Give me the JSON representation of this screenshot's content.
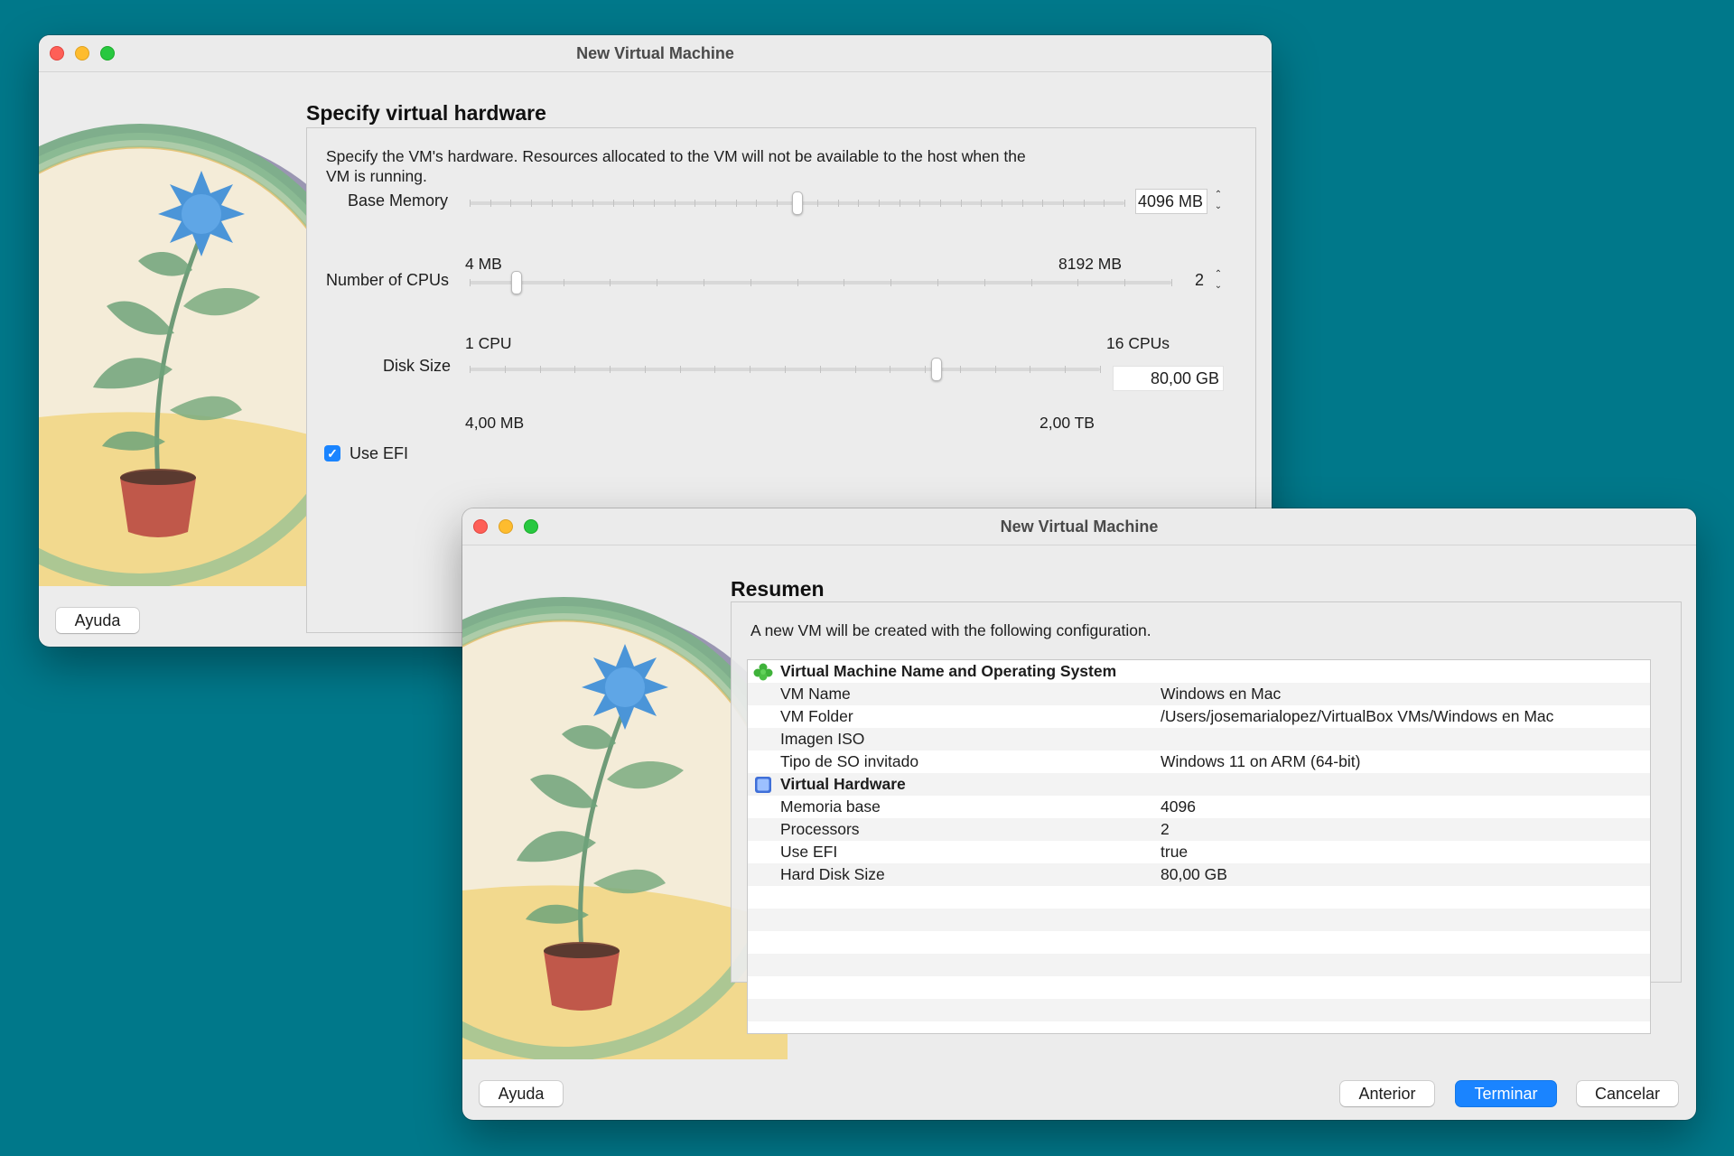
{
  "window1": {
    "title": "New Virtual Machine",
    "heading": "Specify virtual hardware",
    "description_line1": "Specify the VM's hardware. Resources allocated to the VM will not be available to the host when the",
    "description_line2": "VM is running.",
    "base_memory": {
      "label": "Base Memory",
      "value": "4096 MB",
      "min_label": "4 MB",
      "max_label": "8192 MB",
      "level": 0.5
    },
    "cpus": {
      "label": "Number of CPUs",
      "value": "2",
      "min_label": "1 CPU",
      "max_label": "16 CPUs",
      "level": 0.0667
    },
    "disk": {
      "label": "Disk Size",
      "value": "80,00 GB",
      "min_label": "4,00 MB",
      "max_label": "2,00 TB",
      "level": 0.74
    },
    "efi": {
      "label": "Use EFI",
      "checked": true
    },
    "help_button": "Ayuda"
  },
  "window2": {
    "title": "New Virtual Machine",
    "heading": "Resumen",
    "description": "A new VM will be created with the following configuration.",
    "sections": [
      {
        "title": "Virtual Machine Name and Operating System",
        "icon": "green-puzzle-icon",
        "rows": [
          {
            "key": "VM Name",
            "value": "Windows en Mac"
          },
          {
            "key": "VM Folder",
            "value": "/Users/josemarialopez/VirtualBox VMs/Windows en Mac"
          },
          {
            "key": "Imagen ISO",
            "value": ""
          },
          {
            "key": "Tipo de SO invitado",
            "value": "Windows 11 on ARM (64-bit)"
          }
        ]
      },
      {
        "title": "Virtual Hardware",
        "icon": "chip-icon",
        "rows": [
          {
            "key": "Memoria base",
            "value": "4096"
          },
          {
            "key": "Processors",
            "value": "2"
          },
          {
            "key": "Use EFI",
            "value": "true"
          },
          {
            "key": "Hard Disk Size",
            "value": "80,00 GB"
          }
        ]
      }
    ],
    "buttons": {
      "help": "Ayuda",
      "back": "Anterior",
      "finish": "Terminar",
      "cancel": "Cancelar"
    }
  },
  "colors": {
    "desktop": "#00788a",
    "accent": "#1a84ff"
  }
}
